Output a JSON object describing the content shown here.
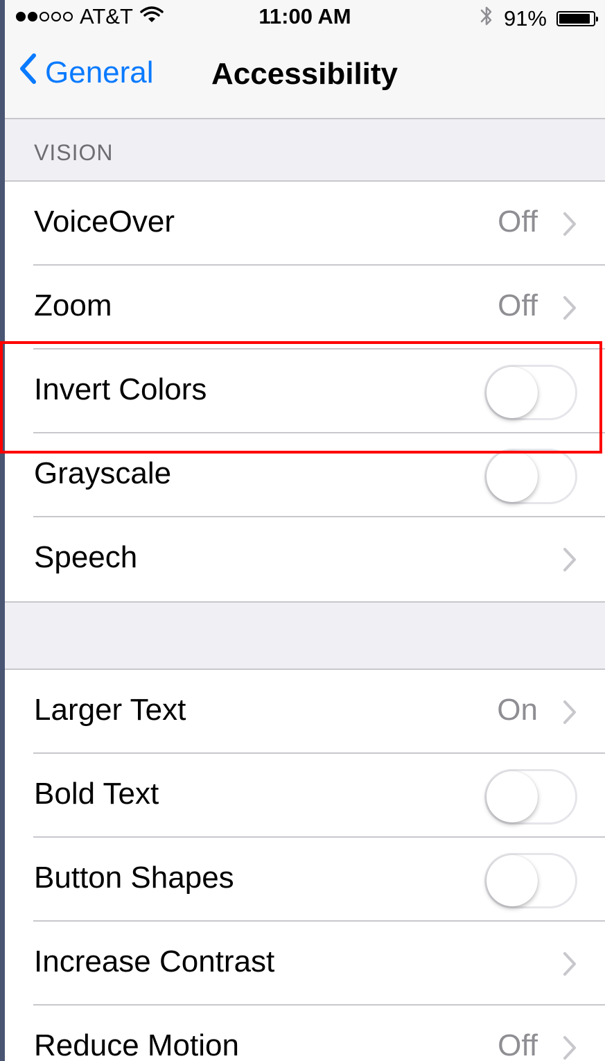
{
  "status_bar": {
    "carrier": "AT&T",
    "signal_dots_filled": 2,
    "signal_dots_total": 5,
    "time": "11:00 AM",
    "battery": "91%",
    "battery_level": 0.91,
    "icons": [
      "wifi-icon",
      "bluetooth-icon",
      "battery-icon"
    ]
  },
  "nav": {
    "back_label": "General",
    "title": "Accessibility",
    "accent_color": "#0a7aff"
  },
  "vision_section": {
    "header": "VISION",
    "rows": [
      {
        "label": "VoiceOver",
        "value": "Off",
        "type": "disclosure"
      },
      {
        "label": "Zoom",
        "value": "Off",
        "type": "disclosure"
      },
      {
        "label": "Invert Colors",
        "type": "toggle",
        "on": false,
        "highlighted": true
      },
      {
        "label": "Grayscale",
        "type": "toggle",
        "on": false
      },
      {
        "label": "Speech",
        "type": "disclosure"
      }
    ]
  },
  "second_section": {
    "rows": [
      {
        "label": "Larger Text",
        "value": "On",
        "type": "disclosure"
      },
      {
        "label": "Bold Text",
        "type": "toggle",
        "on": false
      },
      {
        "label": "Button Shapes",
        "type": "toggle",
        "on": false
      },
      {
        "label": "Increase Contrast",
        "type": "disclosure"
      },
      {
        "label": "Reduce Motion",
        "value": "Off",
        "type": "disclosure"
      }
    ]
  },
  "highlight_color": "#ff0000"
}
